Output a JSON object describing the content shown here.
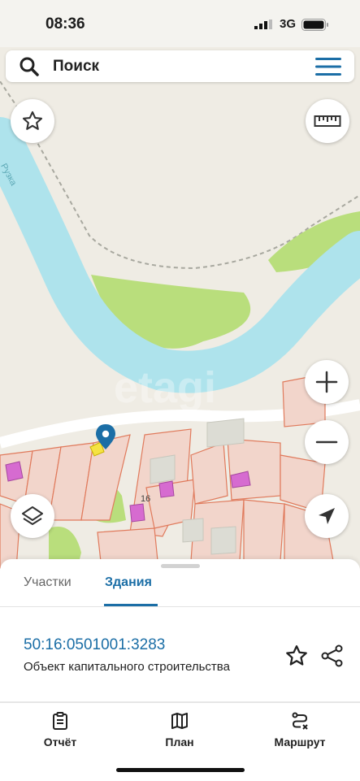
{
  "status_bar": {
    "time": "08:36",
    "network": "3G"
  },
  "search": {
    "label": "Поиск"
  },
  "map": {
    "house_number": "16",
    "river_label": "Рузка",
    "watermark": "etagi"
  },
  "sheet": {
    "tabs": [
      {
        "label": "Участки",
        "active": false
      },
      {
        "label": "Здания",
        "active": true
      }
    ],
    "cadastral_number": "50:16:0501001:3283",
    "object_type": "Объект капитального строительства"
  },
  "navbar": {
    "items": [
      {
        "label": "Отчёт"
      },
      {
        "label": "План"
      },
      {
        "label": "Маршрут"
      }
    ]
  },
  "colors": {
    "accent": "#1b6ea6",
    "water": "#aee3ec",
    "green": "#b9de7c",
    "parcel": "#f2d5cb",
    "building": "#d66bd0"
  }
}
